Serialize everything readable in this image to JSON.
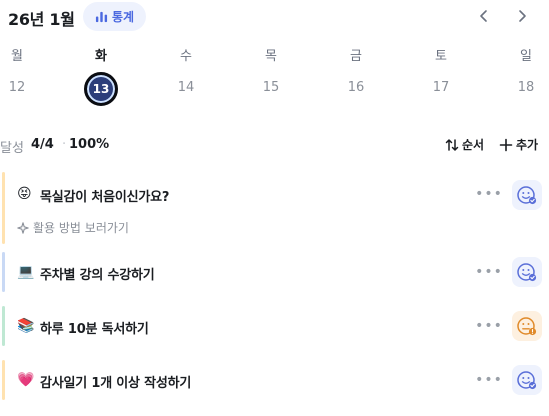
{
  "header": {
    "month_title": "26년 1월",
    "stats_label": "통계"
  },
  "week": [
    {
      "name": "월",
      "date": "12",
      "selected": false
    },
    {
      "name": "화",
      "date": "13",
      "selected": true
    },
    {
      "name": "수",
      "date": "14",
      "selected": false
    },
    {
      "name": "목",
      "date": "15",
      "selected": false
    },
    {
      "name": "금",
      "date": "16",
      "selected": false
    },
    {
      "name": "토",
      "date": "17",
      "selected": false
    },
    {
      "name": "일",
      "date": "18",
      "selected": false
    }
  ],
  "progress": {
    "label": "달성",
    "count": "4/4",
    "separator": "·",
    "percent": "100%",
    "order_label": "순서",
    "add_label": "추가"
  },
  "tasks": [
    {
      "emoji": "😝",
      "title": "목실감이 처음이신가요?",
      "guide": "활용 방법 보러가기",
      "bar_color": "#ffe2b0",
      "status": "done",
      "status_color": "#5a6fd8",
      "status_bg": "#eef2fd"
    },
    {
      "emoji": "💻",
      "title": "주차별 강의 수강하기",
      "bar_color": "#c9d9f5",
      "status": "done",
      "status_color": "#5a6fd8",
      "status_bg": "#eef2fd"
    },
    {
      "emoji": "📚",
      "title": "하루 10분 독서하기",
      "bar_color": "#bfe8d3",
      "status": "warning",
      "status_color": "#e08a2a",
      "status_bg": "#fdf0e0"
    },
    {
      "emoji": "💗",
      "title": "감사일기 1개 이상 작성하기",
      "bar_color": "#ffe2b0",
      "status": "done",
      "status_color": "#5a6fd8",
      "status_bg": "#eef2fd"
    }
  ],
  "icons": {
    "stats": "bar-chart-icon",
    "prev": "chevron-left-icon",
    "next": "chevron-right-icon",
    "order": "sort-arrows-icon",
    "add": "plus-icon",
    "more": "more-dots-icon",
    "guide": "sparkle-icon",
    "status": "smiley-check-icon"
  }
}
